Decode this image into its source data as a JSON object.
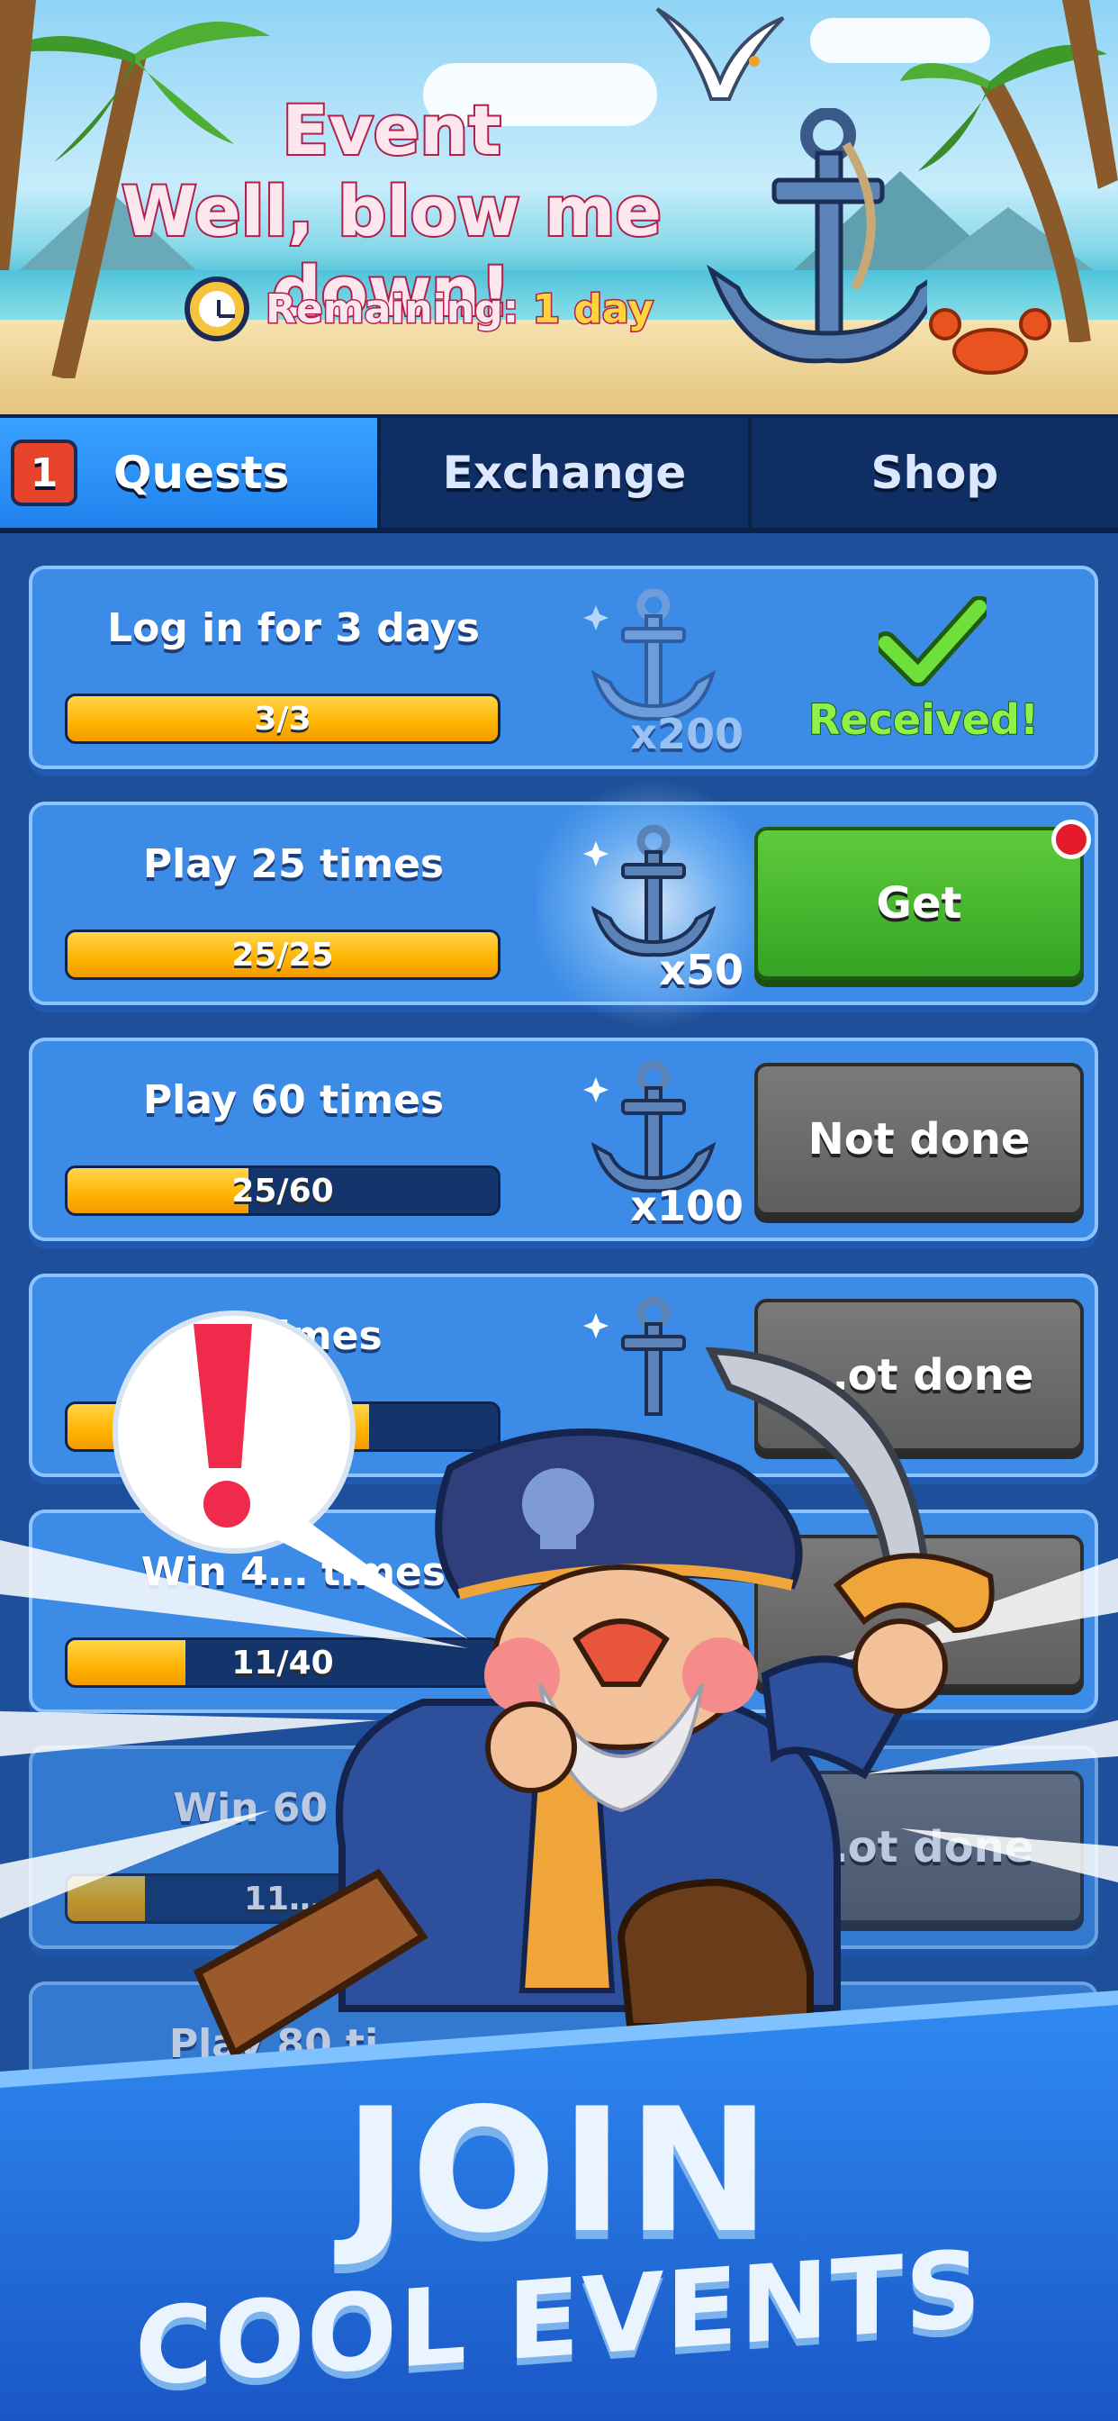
{
  "banner": {
    "event_label": "Event",
    "event_name": "Well, blow me down!",
    "remaining_label": "Remaining:",
    "remaining_value": "1 day"
  },
  "tabs": [
    {
      "label": "Quests",
      "badge": "1",
      "active": true
    },
    {
      "label": "Exchange",
      "active": false
    },
    {
      "label": "Shop",
      "active": false
    }
  ],
  "quests": [
    {
      "title": "Log in for 3 days",
      "progress_text": "3/3",
      "progress": 1.0,
      "reward": "x200",
      "status": "Received!"
    },
    {
      "title": "Play 25 times",
      "progress_text": "25/25",
      "progress": 1.0,
      "reward": "x50",
      "status": "Get"
    },
    {
      "title": "Play 60 times",
      "progress_text": "25/60",
      "progress": 0.42,
      "reward": "x100",
      "status": "Not done"
    },
    {
      "title": "… times",
      "progress_text": "",
      "progress": 0.7,
      "reward": "",
      "status": "…ot done"
    },
    {
      "title": "Win 4… times",
      "progress_text": "11/40",
      "progress": 0.275,
      "reward": "",
      "status": ""
    },
    {
      "title": "Win 60 ti…",
      "progress_text": "11…",
      "progress": 0.18,
      "reward": "",
      "status": "…ot done"
    },
    {
      "title": "Play 80 ti…",
      "progress_text": "",
      "progress": 0,
      "reward": "",
      "status": ""
    }
  ],
  "alert_symbol": "!",
  "promo": {
    "line1": "JOIN",
    "line2": "COOL EVENTS"
  },
  "colors": {
    "accent": "#1f82ee",
    "get_green": "#35a323",
    "received_green": "#8ff048",
    "progress_yellow": "#ffb300"
  }
}
